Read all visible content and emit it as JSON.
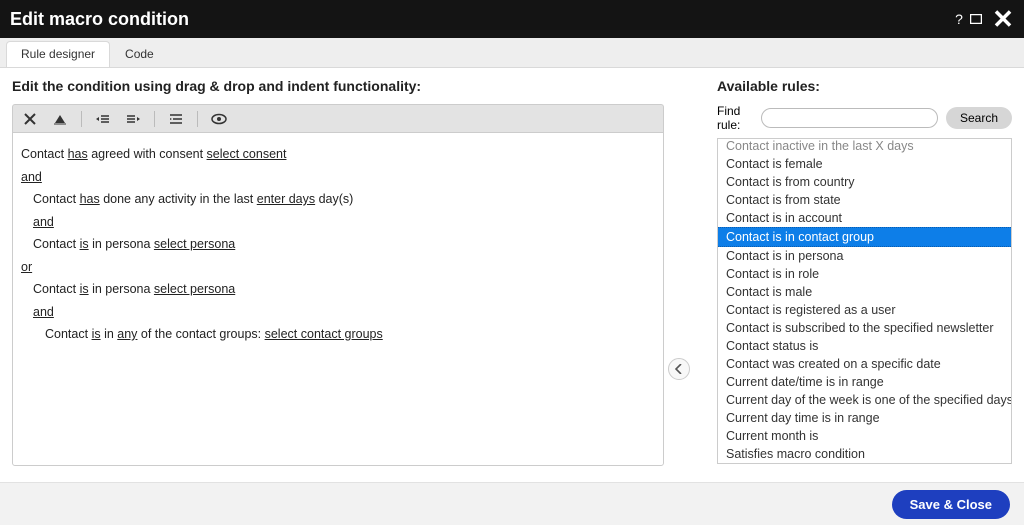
{
  "titlebar": {
    "title": "Edit macro condition"
  },
  "tabs": {
    "designer": "Rule designer",
    "code": "Code",
    "active": "designer"
  },
  "left": {
    "heading": "Edit the condition using drag & drop and indent functionality:",
    "condition": {
      "lines": [
        {
          "indent": 0,
          "parts": [
            "Contact ",
            {
              "u": "has"
            },
            " agreed with consent ",
            {
              "ph": "select consent"
            }
          ]
        },
        {
          "indent": 0,
          "parts": [
            {
              "u": "and"
            }
          ]
        },
        {
          "indent": 1,
          "parts": [
            "Contact ",
            {
              "u": "has"
            },
            " done any activity in the last ",
            {
              "ph": "enter days"
            },
            " day(s)"
          ]
        },
        {
          "indent": 1,
          "parts": [
            {
              "u": "and"
            }
          ]
        },
        {
          "indent": 1,
          "parts": [
            "Contact ",
            {
              "u": "is"
            },
            " in persona ",
            {
              "ph": "select persona"
            }
          ]
        },
        {
          "indent": 0,
          "parts": [
            {
              "u": "or"
            }
          ]
        },
        {
          "indent": 1,
          "parts": [
            "Contact ",
            {
              "u": "is"
            },
            " in persona ",
            {
              "ph": "select persona"
            }
          ]
        },
        {
          "indent": 1,
          "parts": [
            {
              "u": "and"
            }
          ]
        },
        {
          "indent": 2,
          "parts": [
            "Contact ",
            {
              "u": "is"
            },
            " in ",
            {
              "u": "any"
            },
            " of the contact groups: ",
            {
              "ph": "select contact groups"
            }
          ]
        }
      ]
    }
  },
  "right": {
    "heading": "Available rules:",
    "find_label": "Find rule:",
    "search_label": "Search",
    "search_value": "",
    "rules": [
      {
        "label": "Contact inactive in the last X days",
        "partial": true
      },
      {
        "label": "Contact is female"
      },
      {
        "label": "Contact is from country"
      },
      {
        "label": "Contact is from state"
      },
      {
        "label": "Contact is in account"
      },
      {
        "label": "Contact is in contact group",
        "selected": true
      },
      {
        "label": "Contact is in persona"
      },
      {
        "label": "Contact is in role"
      },
      {
        "label": "Contact is male"
      },
      {
        "label": "Contact is registered as a user"
      },
      {
        "label": "Contact is subscribed to the specified newsletter"
      },
      {
        "label": "Contact status is"
      },
      {
        "label": "Contact was created on a specific date"
      },
      {
        "label": "Current date/time is in range"
      },
      {
        "label": "Current day of the week is one of the specified days"
      },
      {
        "label": "Current day time is in range"
      },
      {
        "label": "Current month is"
      },
      {
        "label": "Satisfies macro condition"
      }
    ]
  },
  "footer": {
    "save_close": "Save & Close"
  }
}
